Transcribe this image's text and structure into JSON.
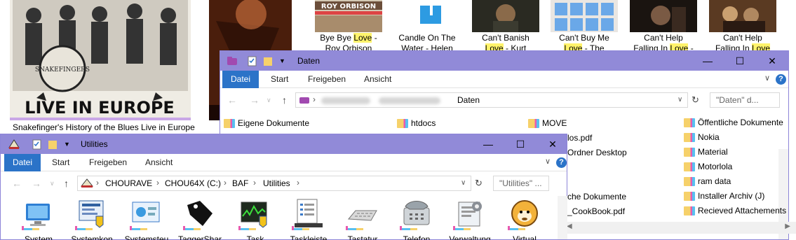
{
  "background": {
    "large_album_caption": "Snakefinger's History of the Blues Live in Europe",
    "large_album_cover_text": "LIVE IN EUROPE",
    "thumbnails": [
      {
        "line1_pre": "Bye Bye ",
        "line1_hl": "Love",
        "line1_post": " -",
        "line2_pre": "Roy Orbison",
        "line2_hl": "",
        "line2_post": "",
        "cover": "roy-orbison"
      },
      {
        "line1_pre": "Candle On The",
        "line1_hl": "",
        "line1_post": "",
        "line2_pre": "Water - Helen",
        "line2_hl": "",
        "line2_post": "",
        "cover": "candle"
      },
      {
        "line1_pre": "Can't Banish",
        "line1_hl": "",
        "line1_post": "",
        "line2_pre": "",
        "line2_hl": "Love",
        "line2_post": " - Kurt",
        "cover": "banish"
      },
      {
        "line1_pre": "Can't Buy Me",
        "line1_hl": "",
        "line1_post": "",
        "line2_pre": "",
        "line2_hl": "Love",
        "line2_post": " - The",
        "cover": "beatles"
      },
      {
        "line1_pre": "Can't Help",
        "line1_hl": "",
        "line1_post": "",
        "line2_pre": "Falling In ",
        "line2_hl": "Love",
        "line2_post": " -",
        "cover": "help1"
      },
      {
        "line1_pre": "Can't Help",
        "line1_hl": "",
        "line1_post": "",
        "line2_pre": "Falling In ",
        "line2_hl": "Love",
        "line2_post": "",
        "cover": "help2"
      }
    ]
  },
  "daten_window": {
    "title": "Daten",
    "tabs": [
      "Datei",
      "Start",
      "Freigeben",
      "Ansicht"
    ],
    "address_last": "Daten",
    "search_placeholder": "\"Daten\" d...",
    "items": [
      {
        "label": "Eigene Dokumente",
        "col": 0
      },
      {
        "label": "htdocs",
        "col": 1
      },
      {
        "label": "MOVE",
        "col": 2
      },
      {
        "label": "Öffentliche Dokumente",
        "col": 3
      },
      {
        "label": "Nokia",
        "col": 3
      },
      {
        "label": "Material",
        "col": 3
      },
      {
        "label": "Motorlola",
        "col": 3
      },
      {
        "label": "ram data",
        "col": 3
      },
      {
        "label": "Installer Archiv (J)",
        "col": 3
      },
      {
        "label": "Recieved Attachements",
        "col": 3
      }
    ],
    "partial_items": [
      "los.pdf",
      "Ordner Desktop",
      "che Dokumente",
      "_CookBook.pdf"
    ]
  },
  "utilities_window": {
    "title": "Utilities",
    "tabs": [
      "Datei",
      "Start",
      "Freigeben",
      "Ansicht"
    ],
    "breadcrumb": [
      "CHOURAVE",
      "CHOU64X (C:)",
      "BAF",
      "Utilities"
    ],
    "search_placeholder": "\"Utilities\" ...",
    "items": [
      {
        "label": "System",
        "icon": "system-icon"
      },
      {
        "label": "Systemkon",
        "icon": "system-config-icon"
      },
      {
        "label": "Systemsteu",
        "icon": "control-panel-icon"
      },
      {
        "label": "TaggerShar",
        "icon": "tag-icon"
      },
      {
        "label": "Task",
        "icon": "task-manager-icon"
      },
      {
        "label": "Taskleiste",
        "icon": "taskbar-icon"
      },
      {
        "label": "Tastatur",
        "icon": "keyboard-icon"
      },
      {
        "label": "Telefon",
        "icon": "telephone-icon"
      },
      {
        "label": "Verwaltung",
        "icon": "administration-icon"
      },
      {
        "label": "Virtual",
        "icon": "virtual-sheep-icon"
      }
    ]
  },
  "colors": {
    "titlebar": "#918ad8",
    "ribbon_active_tab": "#2b73c8",
    "highlight": "#fff36b"
  }
}
